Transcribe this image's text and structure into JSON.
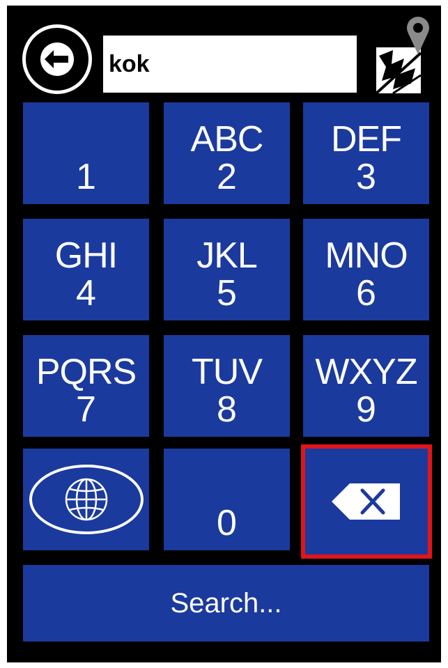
{
  "search": {
    "value": "kok"
  },
  "keypad": {
    "keys": [
      {
        "letters": "",
        "digit": "1"
      },
      {
        "letters": "ABC",
        "digit": "2"
      },
      {
        "letters": "DEF",
        "digit": "3"
      },
      {
        "letters": "GHI",
        "digit": "4"
      },
      {
        "letters": "JKL",
        "digit": "5"
      },
      {
        "letters": "MNO",
        "digit": "6"
      },
      {
        "letters": "PQRS",
        "digit": "7"
      },
      {
        "letters": "TUV",
        "digit": "8"
      },
      {
        "letters": "WXYZ",
        "digit": "9"
      },
      {
        "letters": "",
        "digit": "0"
      }
    ]
  },
  "search_button": {
    "label": "Search..."
  },
  "icons": {
    "back": "back-arrow-icon",
    "map": "map-pin-icon",
    "globe": "globe-icon",
    "backspace": "backspace-icon"
  },
  "colors": {
    "key_blue": "#1b3a9e",
    "highlight_red": "#e0151b",
    "background": "#000000"
  }
}
